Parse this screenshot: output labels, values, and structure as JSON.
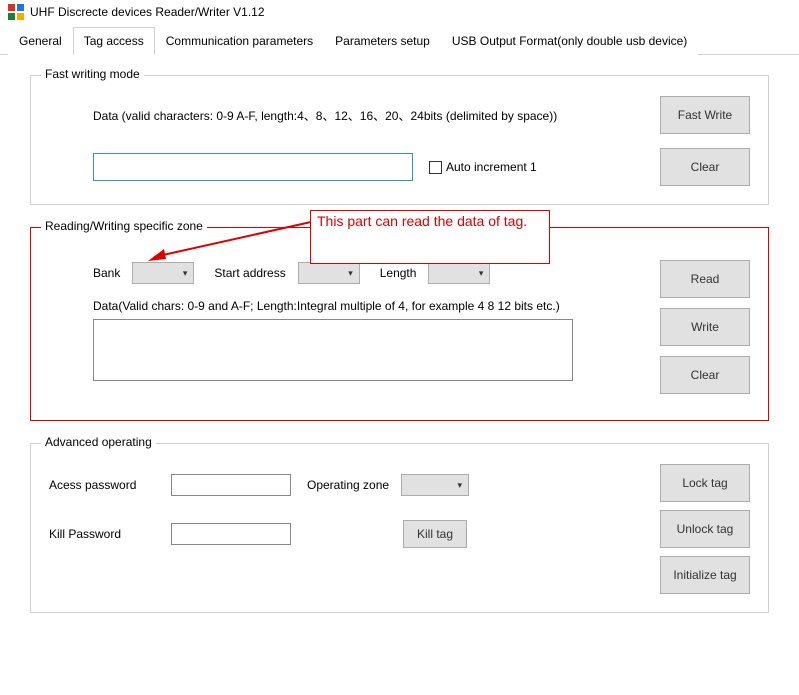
{
  "window": {
    "title": "UHF Discrecte devices Reader/Writer V1.12"
  },
  "tabs": {
    "general": "General",
    "tag_access": "Tag access",
    "comm_params": "Communication parameters",
    "params_setup": "Parameters setup",
    "usb_output": "USB Output Format(only double usb device)"
  },
  "fast_writing": {
    "title": "Fast writing mode",
    "data_label": "Data (valid characters: 0-9 A-F, length:4、8、12、16、20、24bits (delimited by space))",
    "auto_inc_label": "Auto increment 1",
    "fast_write_btn": "Fast Write",
    "clear_btn": "Clear",
    "input_value": ""
  },
  "annotation": {
    "text": "This part can read the data of tag."
  },
  "rw_zone": {
    "title": "Reading/Writing specific zone",
    "bank_label": "Bank",
    "start_addr_label": "Start address",
    "length_label": "Length",
    "data_hint": "Data(Valid chars: 0-9 and A-F; Length:Integral multiple of 4, for example 4 8 12 bits etc.)",
    "read_btn": "Read",
    "write_btn": "Write",
    "clear_btn": "Clear",
    "bank_value": "",
    "start_addr_value": "",
    "length_value": "",
    "data_value": ""
  },
  "advanced": {
    "title": "Advanced operating",
    "access_pw_label": "Acess password",
    "operating_zone_label": "Operating zone",
    "kill_pw_label": "Kill Password",
    "kill_tag_btn": "Kill tag",
    "lock_tag_btn": "Lock tag",
    "unlock_tag_btn": "Unlock tag",
    "initialize_tag_btn": "Initialize tag",
    "access_pw_value": "",
    "kill_pw_value": "",
    "operating_zone_value": ""
  }
}
